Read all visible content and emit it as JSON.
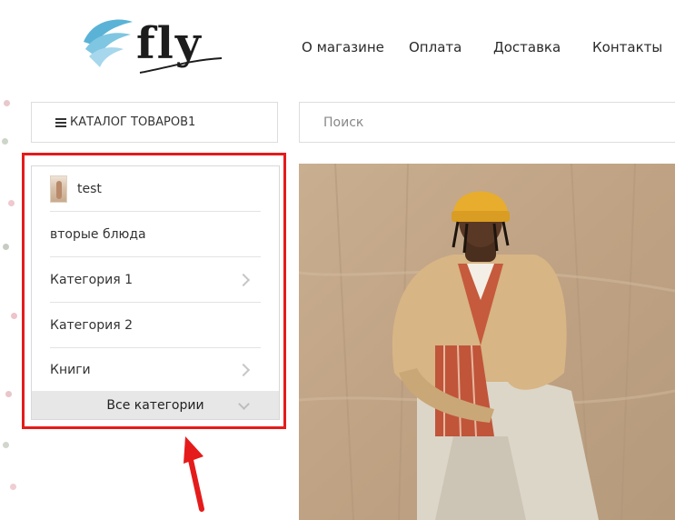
{
  "logo": {
    "text": "fly"
  },
  "nav": {
    "items": [
      {
        "label": "О магазине"
      },
      {
        "label": "Оплата"
      },
      {
        "label": "Доставка"
      },
      {
        "label": "Контакты"
      }
    ]
  },
  "catalog": {
    "button_label": "КАТАЛОГ ТОВАРОВ1"
  },
  "search": {
    "placeholder": "Поиск"
  },
  "menu": {
    "items": [
      {
        "label": "test",
        "has_thumbnail": true,
        "has_submenu": false
      },
      {
        "label": "вторые блюда",
        "has_thumbnail": false,
        "has_submenu": false
      },
      {
        "label": "Категория 1",
        "has_thumbnail": false,
        "has_submenu": true
      },
      {
        "label": "Категория 2",
        "has_thumbnail": false,
        "has_submenu": false
      },
      {
        "label": "Книги",
        "has_thumbnail": false,
        "has_submenu": true
      }
    ],
    "all_categories_label": "Все категории"
  },
  "colors": {
    "highlight": "#e51b1b",
    "logo_wing": "#5ab3d6",
    "hat": "#e8ad2c",
    "jacket": "#d7b585",
    "backdrop": "#c5aa8c"
  }
}
